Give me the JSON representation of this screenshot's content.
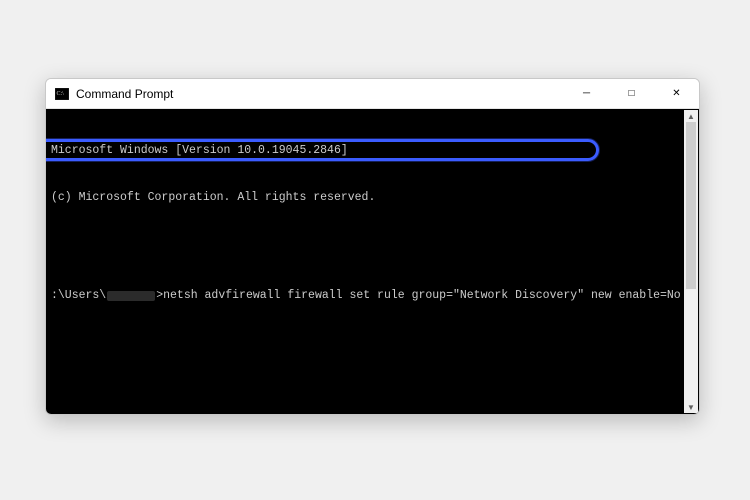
{
  "window": {
    "title": "Command Prompt",
    "controls": {
      "minimize": "─",
      "maximize": "□",
      "close": "✕"
    }
  },
  "terminal": {
    "line1": "Microsoft Windows [Version 10.0.19045.2846]",
    "line2": "(c) Microsoft Corporation. All rights reserved.",
    "prompt_prefix": ":\\Users\\",
    "prompt_suffix": ">",
    "command": "netsh advfirewall firewall set rule group=\"Network Discovery\" new enable=No"
  },
  "annotation": {
    "highlight_color": "#3b5cff"
  }
}
